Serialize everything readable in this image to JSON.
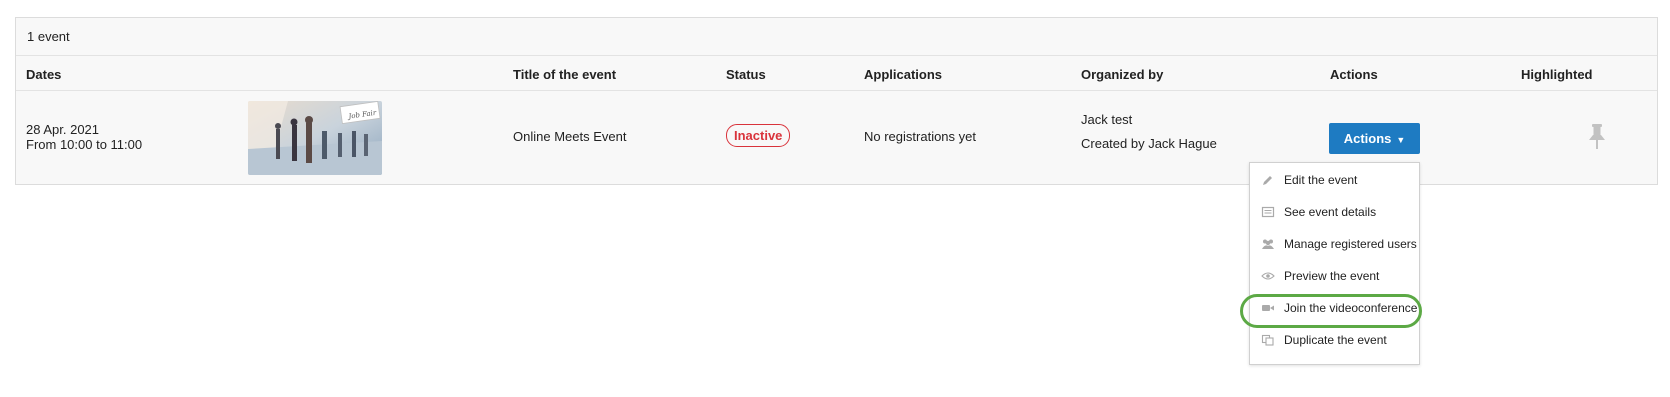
{
  "list": {
    "count_label": "1 event",
    "columns": {
      "dates": "Dates",
      "title": "Title of the event",
      "status": "Status",
      "applications": "Applications",
      "organized_by": "Organized by",
      "actions": "Actions",
      "highlighted": "Highlighted"
    },
    "rows": [
      {
        "date": "28 Apr. 2021",
        "time": "From 10:00 to 11:00",
        "image_sign": "Job Fair",
        "title": "Online Meets Event",
        "status": "Inactive",
        "applications": "No registrations yet",
        "organizer": "Jack test",
        "created_by": "Created by Jack Hague",
        "actions_label": "Actions"
      }
    ]
  },
  "actions_menu": {
    "items": [
      {
        "label": "Edit the event",
        "icon": "pencil-icon"
      },
      {
        "label": "See event details",
        "icon": "details-icon"
      },
      {
        "label": "Manage registered users",
        "icon": "users-icon"
      },
      {
        "label": "Preview the event",
        "icon": "eye-icon"
      },
      {
        "label": "Join the videoconference",
        "icon": "video-camera-icon"
      },
      {
        "label": "Duplicate the event",
        "icon": "duplicate-icon"
      }
    ],
    "highlighted_item": "Join the videoconference"
  },
  "colors": {
    "primary": "#1e7bc2",
    "inactive_status": "#d9333b",
    "highlight_ring": "#5ca945"
  }
}
